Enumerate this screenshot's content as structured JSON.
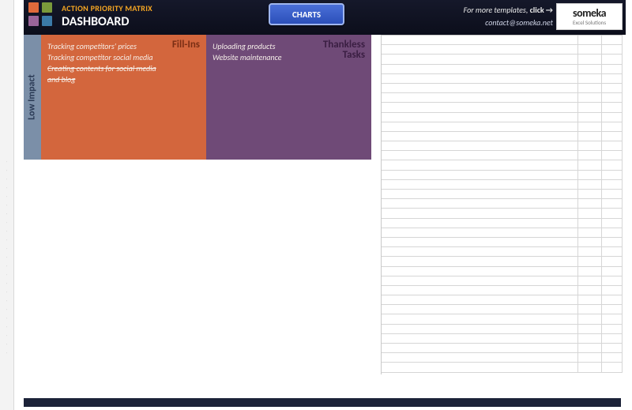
{
  "header": {
    "title_small": "ACTION PRIORITY MATRIX",
    "title_big": "DASHBOARD",
    "charts_button": "CHARTS",
    "more_templates_text": "For more templates, ",
    "more_templates_link": "click →",
    "contact_email": "contact@someka.net",
    "brand_name": "someka",
    "brand_sub": "Excel Solutions"
  },
  "matrix": {
    "y_axis_label": "Low Impact",
    "quadrants": {
      "fill_ins": {
        "label": "Fill-Ins",
        "items": [
          {
            "text": "Tracking competitors' prices",
            "struck": false
          },
          {
            "text": "Tracking competitor social media",
            "struck": false
          },
          {
            "text": "Creating contents for social media and blog",
            "struck": true
          }
        ]
      },
      "thankless": {
        "label": "Thankless\nTasks",
        "items": [
          {
            "text": "Uploading products",
            "struck": false
          },
          {
            "text": "Website maintenance",
            "struck": false
          }
        ]
      }
    }
  },
  "grid": {
    "rows": 35,
    "cols": 3
  }
}
